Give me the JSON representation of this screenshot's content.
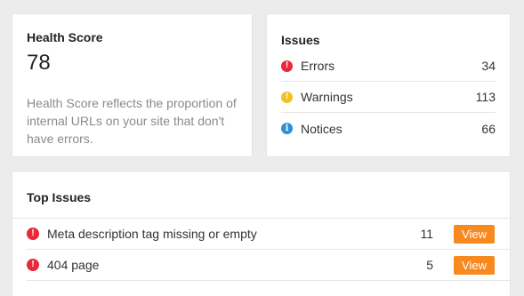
{
  "health": {
    "title": "Health Score",
    "score": "78",
    "description": "Health Score reflects the proportion of internal URLs on your site that don't have errors."
  },
  "issues": {
    "title": "Issues",
    "items": [
      {
        "label": "Errors",
        "count": "34",
        "icon": "error-icon",
        "color": "#e8283b"
      },
      {
        "label": "Warnings",
        "count": "113",
        "icon": "warning-icon",
        "color": "#f3c020"
      },
      {
        "label": "Notices",
        "count": "66",
        "icon": "info-icon",
        "color": "#2d8fd6"
      }
    ]
  },
  "top_issues": {
    "title": "Top Issues",
    "rows": [
      {
        "label": "Meta description tag missing or empty",
        "count": "11",
        "button": "View",
        "icon": "error-icon"
      },
      {
        "label": "404 page",
        "count": "5",
        "button": "View",
        "icon": "error-icon"
      }
    ]
  },
  "colors": {
    "accent": "#f7891f",
    "error": "#e8283b",
    "warning": "#f3c020",
    "info": "#2d8fd6"
  }
}
